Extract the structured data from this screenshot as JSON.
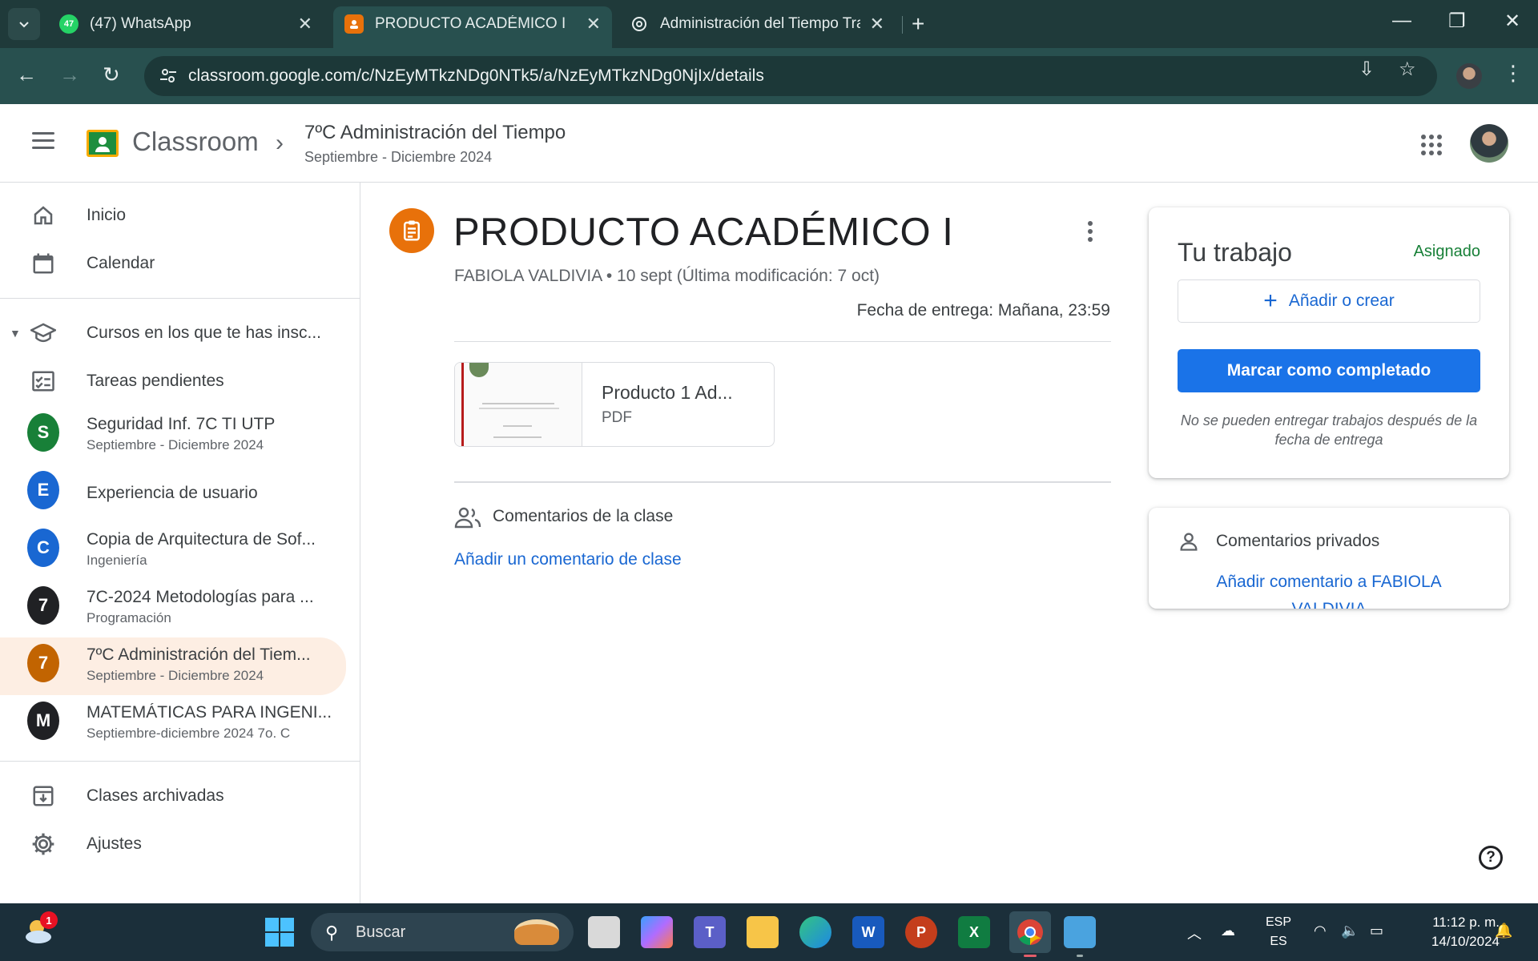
{
  "browser": {
    "tabs": [
      {
        "title": "(47) WhatsApp",
        "badge": "47",
        "active": false
      },
      {
        "title": "PRODUCTO ACADÉMICO I",
        "active": true
      },
      {
        "title": "Administración del Tiempo Trab",
        "active": false
      }
    ],
    "url": "classroom.google.com/c/NzEyMTkzNDg0NTk5/a/NzEyMTkzNDg0NjIx/details"
  },
  "header": {
    "brand": "Classroom",
    "course_title": "7ºC Administración del Tiempo",
    "course_period": "Septiembre - Diciembre 2024"
  },
  "sidebar": {
    "home": "Inicio",
    "calendar": "Calendar",
    "enrolled": "Cursos en los que te has insc...",
    "todo": "Tareas pendientes",
    "courses": [
      {
        "initial": "S",
        "name": "Seguridad Inf. 7C TI UTP",
        "sub": "Septiembre - Diciembre 2024",
        "color": "#188038"
      },
      {
        "initial": "E",
        "name": "Experiencia de usuario",
        "sub": "",
        "color": "#1967d2"
      },
      {
        "initial": "C",
        "name": "Copia de Arquitectura de Sof...",
        "sub": "Ingeniería",
        "color": "#1967d2"
      },
      {
        "initial": "7",
        "name": "7C-2024 Metodologías para ...",
        "sub": "Programación",
        "color": "#202124"
      },
      {
        "initial": "7",
        "name": "7ºC Administración del Tiem...",
        "sub": "Septiembre - Diciembre 2024",
        "color": "#c26401"
      },
      {
        "initial": "M",
        "name": "MATEMÁTICAS PARA INGENI...",
        "sub": "Septiembre-diciembre 2024 7o. C",
        "color": "#202124"
      }
    ],
    "archived": "Clases archivadas",
    "settings": "Ajustes"
  },
  "assignment": {
    "title": "PRODUCTO ACADÉMICO I",
    "meta": "FABIOLA VALDIVIA • 10 sept (Última modificación: 7 oct)",
    "due": "Fecha de entrega: Mañana, 23:59",
    "attachment": {
      "name": "Producto 1 Ad...",
      "type": "PDF"
    },
    "class_comments_label": "Comentarios de la clase",
    "add_class_comment": "Añadir un comentario de clase"
  },
  "work": {
    "title": "Tu trabajo",
    "status": "Asignado",
    "add_label": "Añadir o crear",
    "done_label": "Marcar como completado",
    "note": "No se pueden entregar trabajos después de la fecha de entrega"
  },
  "private": {
    "label": "Comentarios privados",
    "add": "Añadir comentario a FABIOLA VALDIVIA"
  },
  "taskbar": {
    "search_placeholder": "Buscar",
    "weather_badge": "1",
    "lang_top": "ESP",
    "lang_bottom": "ES",
    "time": "11:12 p. m.",
    "date": "14/10/2024"
  },
  "colors": {
    "accent": "#1a73e8",
    "assignment_icon": "#e8710a",
    "status_green": "#188038",
    "chrome_tab_bar": "#1f3a3a"
  }
}
